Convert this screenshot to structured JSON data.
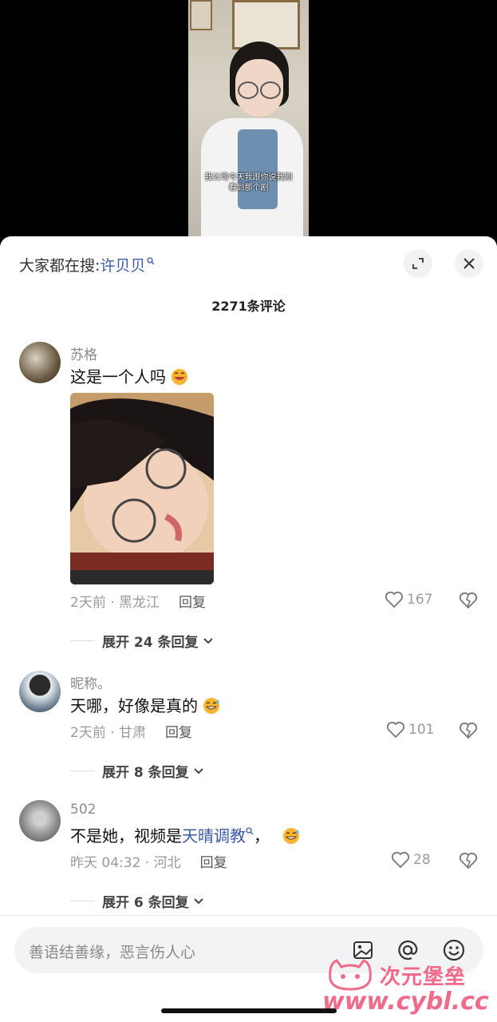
{
  "video": {
    "caption_line1": "我公司今天我跟你说我刚",
    "caption_line2": "看到那个剧"
  },
  "header": {
    "search_prefix": "大家都在搜:",
    "search_term": "许贝贝",
    "search_icon": "search-icon",
    "expand_icon": "expand-icon",
    "close_icon": "close-icon",
    "comment_count": "2271条评论"
  },
  "comments": [
    {
      "username": "苏格",
      "text": "这是一个人吗",
      "emoji": "laughing-emoji",
      "time": "2天前 · 黑龙江",
      "reply": "回复",
      "likes": "167",
      "expand": "展开 24 条回复"
    },
    {
      "username": "昵称。",
      "text": "天哪，好像是真的",
      "emoji": "sweat-smile-emoji",
      "time": "2天前 · 甘肃",
      "reply": "回复",
      "likes": "101",
      "expand": "展开 8 条回复"
    },
    {
      "username": "502",
      "text_before": "不是她，视频是",
      "hashtag": "天晴调教",
      "text_after": "，",
      "emoji": "sweat-smile-emoji",
      "time": "昨天 04:32 · 河北",
      "reply": "回复",
      "likes": "28",
      "expand": "展开 6 条回复"
    }
  ],
  "composer": {
    "placeholder": "善语结善缘，恶言伤人心",
    "image_icon": "image-icon",
    "at_icon": "at-icon",
    "emoji_icon": "emoji-icon"
  },
  "watermark": {
    "logo_text": "次元堡垒",
    "url": "www.cybl.cc"
  },
  "colors": {
    "link": "#3a5aa6",
    "watermark": "#f06a8a"
  }
}
